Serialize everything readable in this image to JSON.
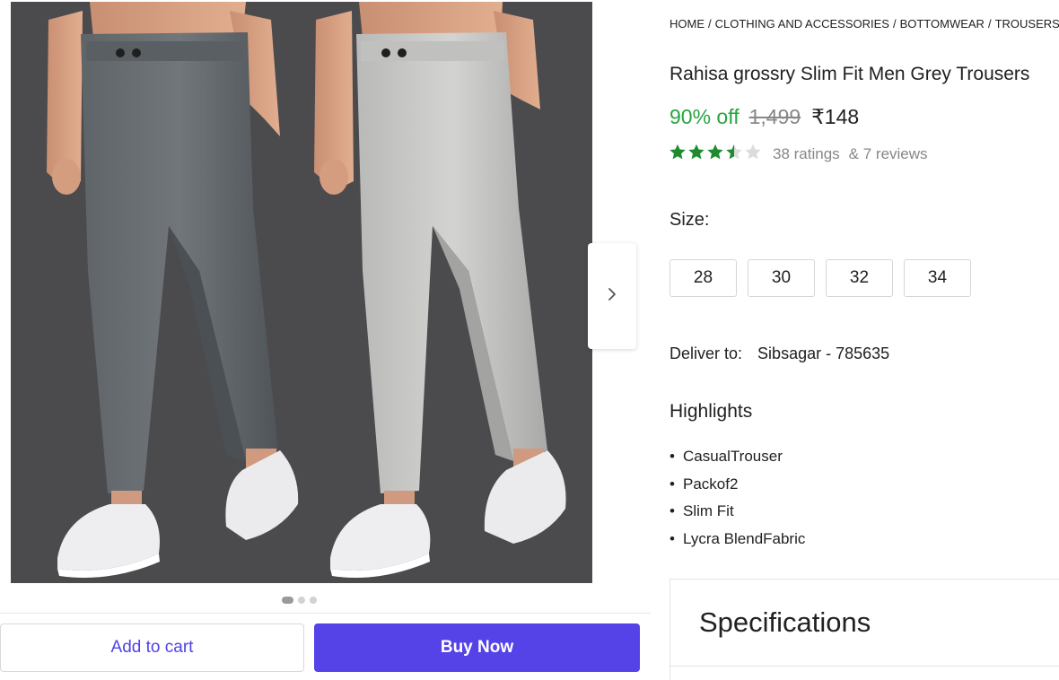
{
  "breadcrumb": [
    "HOME",
    "CLOTHING AND ACCESSORIES",
    "BOTTOMWEAR",
    "TROUSERS"
  ],
  "product": {
    "title": "Rahisa grossry Slim Fit Men Grey Trousers",
    "discount": "90% off",
    "mrp": "1,499",
    "price": "₹148",
    "rating_value": 3.5,
    "rating_max": 5,
    "ratings": "38 ratings",
    "reviews": "& 7 reviews"
  },
  "size": {
    "label": "Size:",
    "options": [
      "28",
      "30",
      "32",
      "34"
    ]
  },
  "delivery": {
    "label": "Deliver to:",
    "location": "Sibsagar - 785635"
  },
  "highlights": {
    "title": "Highlights",
    "items": [
      "CasualTrouser",
      "Packof2",
      "Slim Fit",
      "Lycra BlendFabric"
    ]
  },
  "specifications": {
    "title": "Specifications"
  },
  "actions": {
    "add_to_cart": "Add to cart",
    "buy_now": "Buy Now"
  },
  "carousel": {
    "active_index": 0,
    "count": 3
  },
  "colors": {
    "discount_green": "#26a541",
    "star_green": "#1e8c2e",
    "brand_purple": "#5543e8",
    "image_bg": "#4b4b4e"
  },
  "icons": {
    "next": "chevron-right-icon",
    "star": "star-icon"
  }
}
